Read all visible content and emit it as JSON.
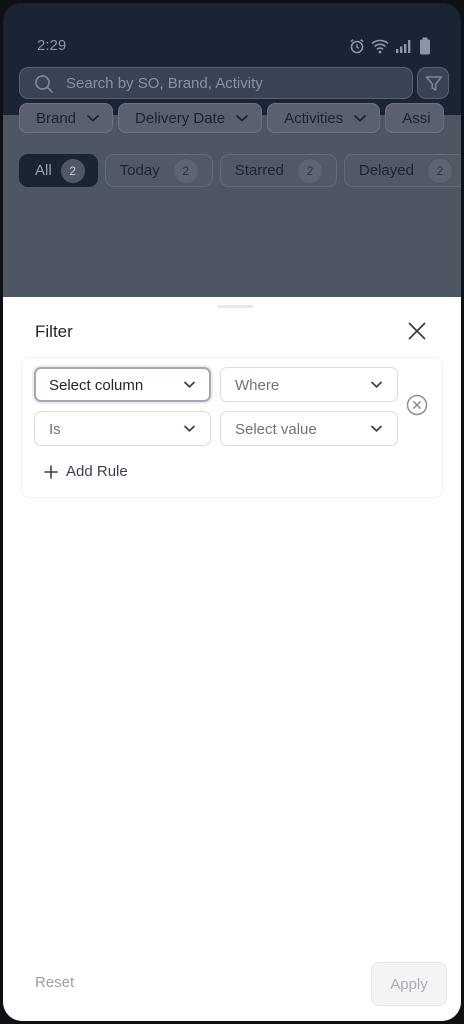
{
  "status_bar": {
    "time": "2:29",
    "icons": [
      "alarm-icon",
      "wifi-icon",
      "signal-icon",
      "battery-icon"
    ]
  },
  "search": {
    "placeholder": "Search by SO, Brand, Activity"
  },
  "filter_chips": [
    {
      "label": "Brand"
    },
    {
      "label": "Delivery Date"
    },
    {
      "label": "Activities"
    },
    {
      "label": "Assi"
    }
  ],
  "segments": [
    {
      "label": "All",
      "count": "2",
      "active": true
    },
    {
      "label": "Today",
      "count": "2",
      "active": false
    },
    {
      "label": "Starred",
      "count": "2",
      "active": false
    },
    {
      "label": "Delayed",
      "count": "2",
      "active": false
    }
  ],
  "filter_sheet": {
    "title": "Filter",
    "rule": {
      "column_placeholder": "Select column",
      "operator_placeholder": "Where",
      "condition_value": "Is",
      "value_placeholder": "Select value"
    },
    "add_rule_label": "Add Rule",
    "reset_label": "Reset",
    "apply_label": "Apply"
  },
  "colors": {
    "overlay_dim": "#4e5664",
    "sheet_bg": "#ffffff",
    "active_segment": "#1b2433",
    "apply_disabled_text": "#a9aeb7"
  }
}
